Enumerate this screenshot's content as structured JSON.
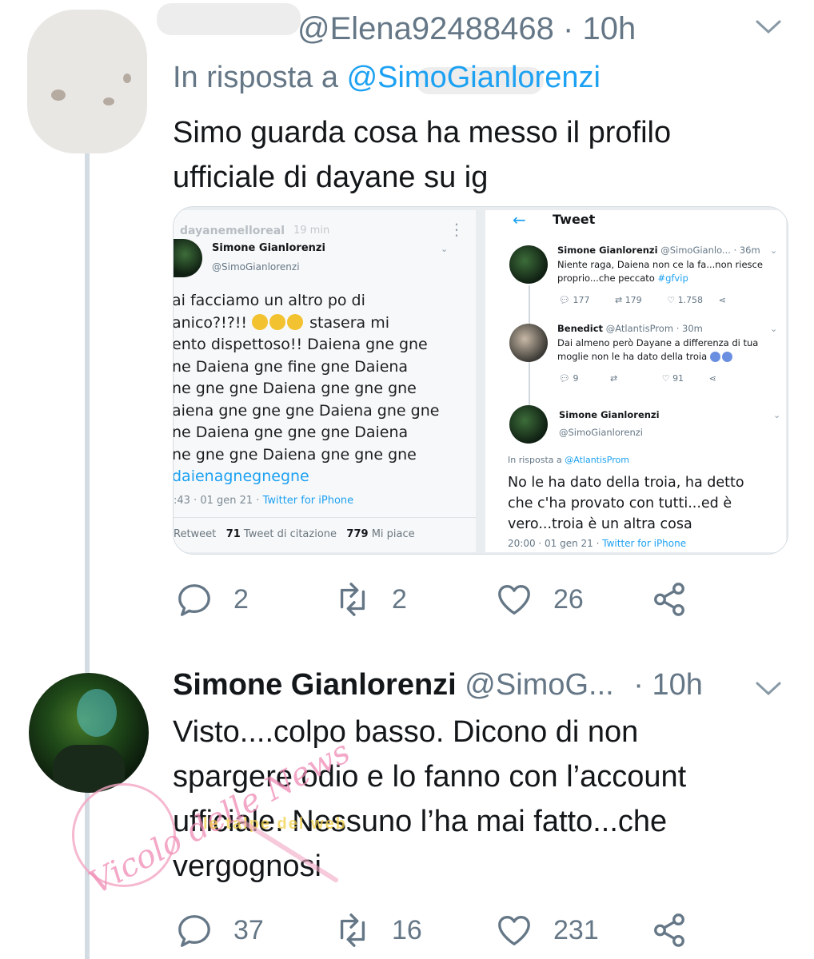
{
  "tweet1": {
    "handle": "@Elena92488468",
    "separator": "·",
    "time": "10h",
    "reply_prefix": "In risposta a",
    "reply_handle": "@SimoGianlorenzi",
    "text_line1": "Simo guarda cosa ha messo il profilo",
    "text_line2": "ufficiale di dayane su ig",
    "actions": {
      "replies": "2",
      "retweets": "2",
      "likes": "26"
    },
    "media_left": {
      "ig_account": "dayanemelloreal",
      "ig_time": "19 min",
      "name": "Simone Gianlorenzi",
      "handle": "@SimoGianlorenzi",
      "lines": [
        "ai facciamo un altro po di",
        "anico?!?!!",
        "stasera mi",
        "ento dispettoso!! Daiena gne gne",
        "ne Daiena gne fine gne Daiena",
        "ne gne gne Daiena gne gne gne",
        "aiena gne gne gne Daiena gne gne",
        "ne Daiena gne gne gne Daiena",
        "ne gne gne Daiena gne gne gne",
        "daienagnegnegne"
      ],
      "meta_time": ":43 · 01 gen 21 ·",
      "meta_source": "Twitter for iPhone",
      "stat_retweet_label": "Retweet",
      "stat_quote_count": "71",
      "stat_quote_label": "Tweet di citazione",
      "stat_like_count": "779",
      "stat_like_label": "Mi piace"
    },
    "media_right": {
      "header": "Tweet",
      "tw1_name": "Simone Gianlorenzi",
      "tw1_handle_time": "@SimoGianlo... · 36m",
      "tw1_line1": "Niente raga, Daiena non ce la fa...non riesce",
      "tw1_line2": "proprio...che peccato",
      "tw1_hashtag": "#gfvip",
      "tw1_replies": "177",
      "tw1_retweets": "179",
      "tw1_likes": "1.758",
      "tw2_name": "Benedict",
      "tw2_handle_time": "@AtlantisProm · 30m",
      "tw2_line1": "Dai almeno però Dayane a differenza di tua",
      "tw2_line2": "moglie non le ha dato della troia",
      "tw2_replies": "9",
      "tw2_likes": "91",
      "tw3_name": "Simone Gianlorenzi",
      "tw3_handle": "@SimoGianlorenzi",
      "tw3_reply_prefix": "In risposta a",
      "tw3_reply_handle": "@AtlantisProm",
      "tw3_line1": "No le ha dato della troia, ha detto",
      "tw3_line2": "che c'ha provato con tutti...ed è",
      "tw3_line3": "vero...troia è un altra cosa",
      "tw3_meta_time": "20:00 · 01 gen 21 ·",
      "tw3_meta_source": "Twitter for iPhone"
    }
  },
  "tweet2": {
    "name": "Simone Gianlorenzi",
    "handle": "@SimoG...",
    "separator": "·",
    "time": "10h",
    "text_line1": "Visto....colpo basso. Dicono di non",
    "text_line2": "spargere odio e lo fanno con l’account",
    "text_line3": "ufficiale. Nessuno l’ha mai fatto...che",
    "text_line4": "vergognosi",
    "actions": {
      "replies": "37",
      "retweets": "16",
      "likes": "231"
    }
  },
  "watermark": {
    "title": "Vicolo delle News",
    "subtitle": "le talpe del web"
  },
  "colors": {
    "link": "#1da1f2",
    "secondary_text": "#657786",
    "thread_line": "#d3dce3"
  }
}
